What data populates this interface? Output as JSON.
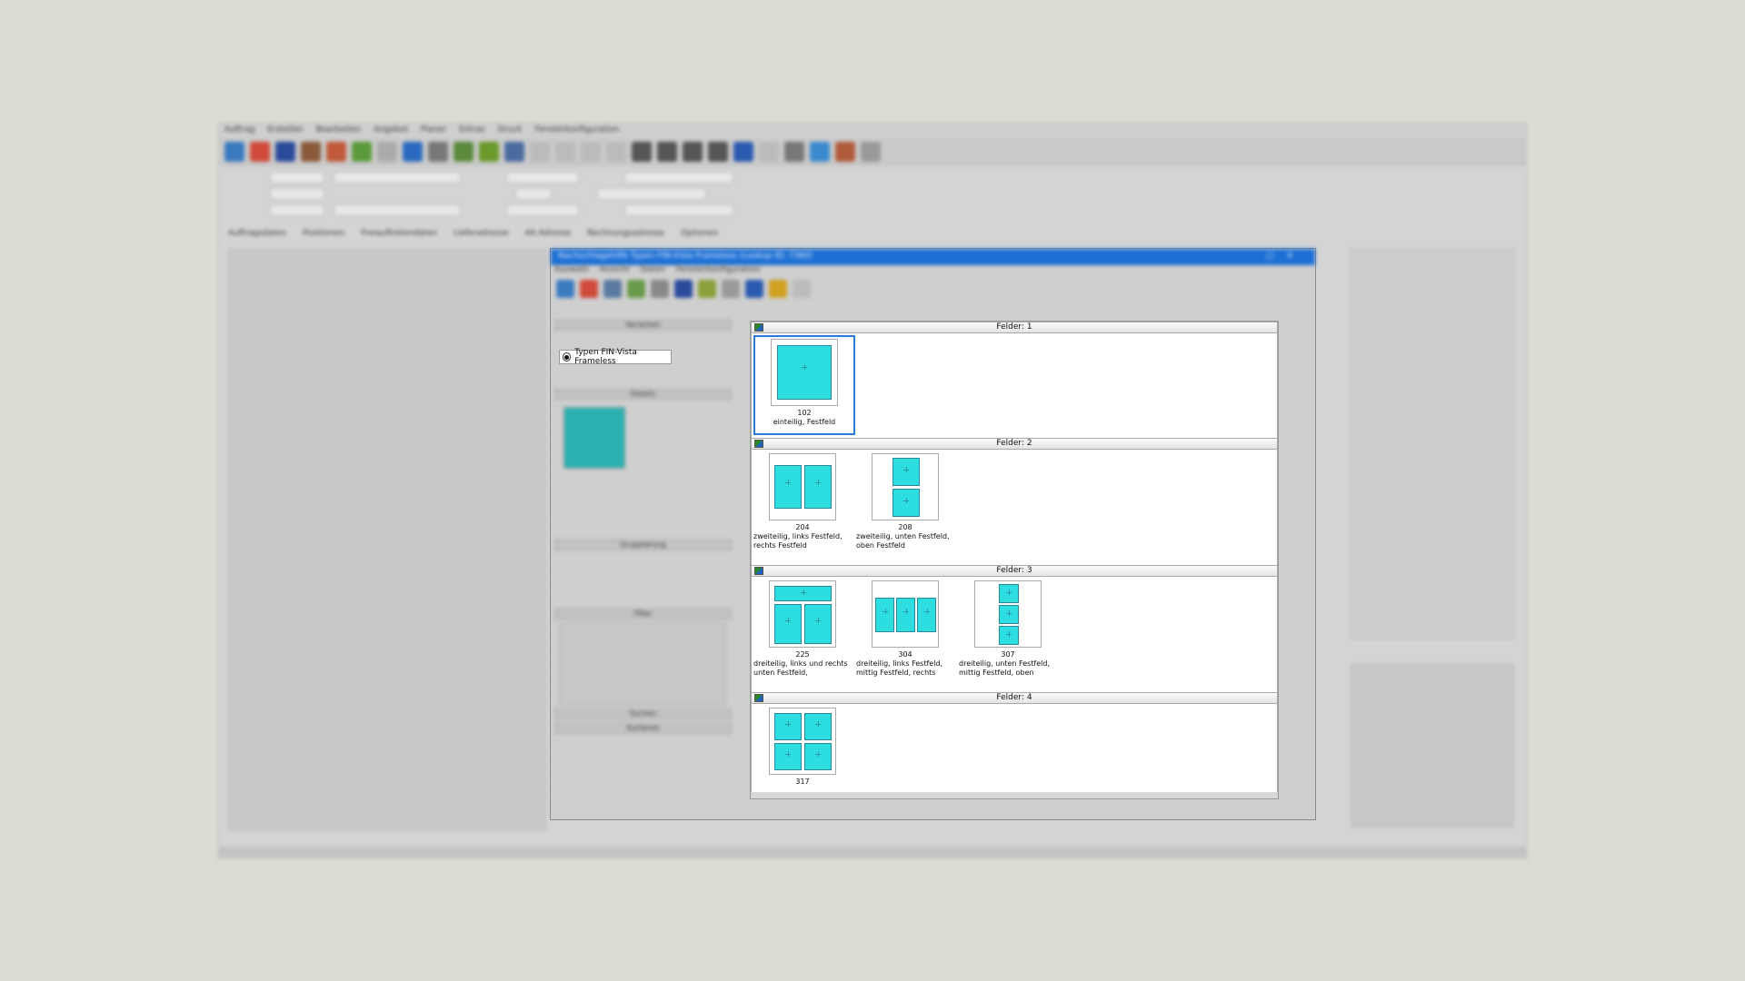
{
  "app": {
    "menu": [
      "Auftrag",
      "Erstellen",
      "Bearbeiten",
      "Angebot",
      "Planer",
      "Extras",
      "Druck",
      "Fensterkonfiguration"
    ],
    "subtabs": [
      "Auftragsdaten",
      "Positionen",
      "Freiauftretendaten",
      "Lieferadresse",
      "Alt.Adresse",
      "Rechnungsadresse",
      "Optionen"
    ]
  },
  "dialog": {
    "title": "Nachschlagehilfe Typen FIN-Vista Frameless (Lookup ID: 7360)",
    "menu": [
      "Auswahl",
      "Ansicht",
      "Daten",
      "Fensterkonfiguration"
    ],
    "left": {
      "section_varianten": "Varianten",
      "radio_selected": "Typen FIN-Vista Frameless",
      "section_details": "Details",
      "section_gruppierung": "Gruppierung",
      "section_filter": "Filter",
      "section_suchen": "Suchen",
      "section_sortieren": "Sortieren"
    },
    "gallery": {
      "groups": [
        {
          "header": "Felder: 1",
          "tiles": [
            {
              "num": "102",
              "desc": "einteilig, Festfeld"
            }
          ]
        },
        {
          "header": "Felder: 2",
          "tiles": [
            {
              "num": "204",
              "desc": "zweiteilig, links Festfeld, rechts Festfeld"
            },
            {
              "num": "208",
              "desc": "zweiteilig, unten Festfeld, oben Festfeld"
            }
          ]
        },
        {
          "header": "Felder: 3",
          "tiles": [
            {
              "num": "225",
              "desc": "dreiteilig, links und rechts unten Festfeld,"
            },
            {
              "num": "304",
              "desc": "dreiteilig, links Festfeld, mittig Festfeld, rechts"
            },
            {
              "num": "307",
              "desc": "dreiteilig, unten Festfeld, mittig Festfeld, oben"
            }
          ]
        },
        {
          "header": "Felder: 4",
          "tiles": [
            {
              "num": "317",
              "desc": ""
            }
          ]
        }
      ]
    }
  },
  "colors": {
    "pane": "#2cdee0",
    "selection": "#2a7ad8",
    "title_bar": "#1c6fd4"
  }
}
